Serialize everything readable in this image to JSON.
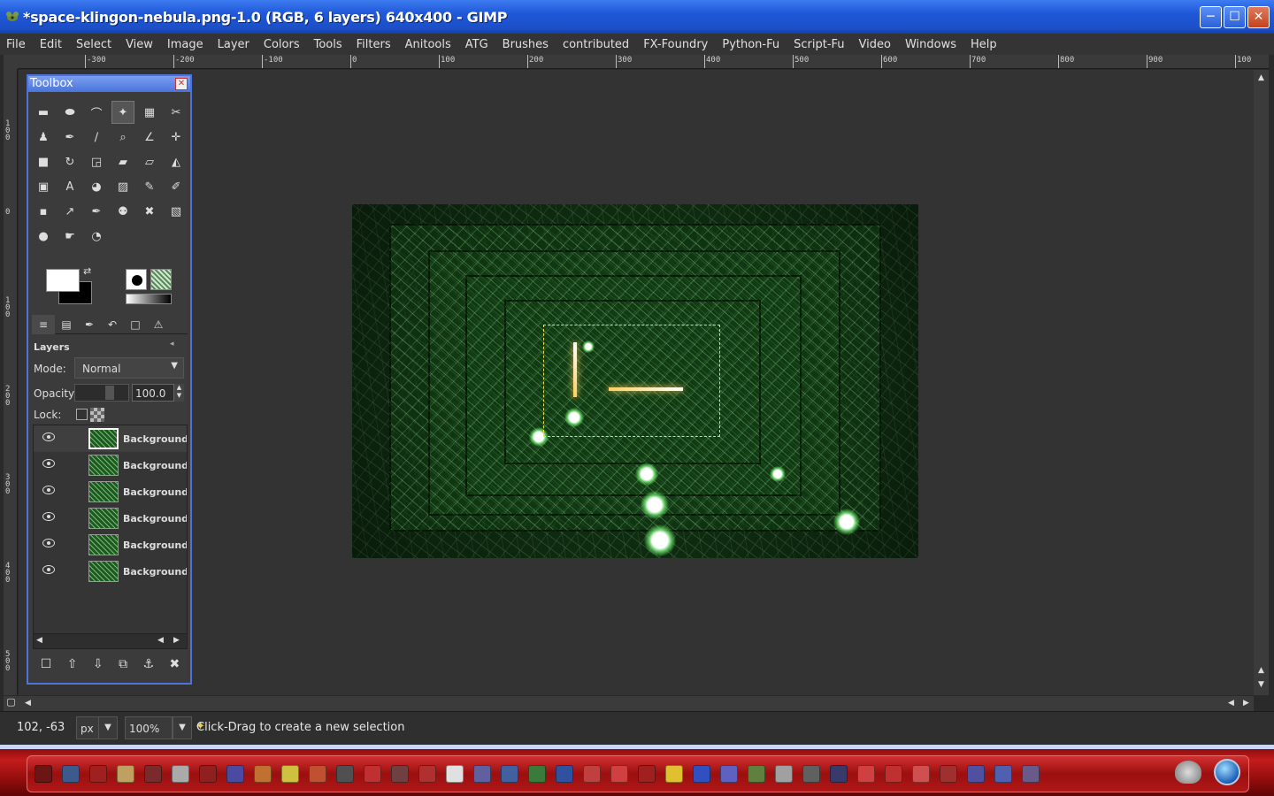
{
  "window": {
    "title": "*space-klingon-nebula.png-1.0 (RGB, 6 layers) 640x400 - GIMP",
    "minimize": "─",
    "maximize": "☐",
    "close": "✕"
  },
  "menubar": [
    "File",
    "Edit",
    "Select",
    "View",
    "Image",
    "Layer",
    "Colors",
    "Tools",
    "Filters",
    "Anitools",
    "ATG",
    "Brushes",
    "contributed",
    "FX-Foundry",
    "Python-Fu",
    "Script-Fu",
    "Video",
    "Windows",
    "Help"
  ],
  "ruler_top": [
    "-300",
    "-200",
    "-100",
    "0",
    "100",
    "200",
    "300",
    "400",
    "500",
    "600",
    "700",
    "800",
    "900",
    "100"
  ],
  "ruler_left": [
    "100",
    "0",
    "100",
    "200",
    "300",
    "400",
    "500"
  ],
  "toolbox": {
    "title": "Toolbox",
    "close": "✕",
    "tools": [
      {
        "icon": "rect-select-icon",
        "glyph": "▬"
      },
      {
        "icon": "ellipse-select-icon",
        "glyph": "⬬"
      },
      {
        "icon": "free-select-icon",
        "glyph": "⌒"
      },
      {
        "icon": "fuzzy-select-icon",
        "glyph": "✦"
      },
      {
        "icon": "select-by-color-icon",
        "glyph": "▦"
      },
      {
        "icon": "scissors-select-icon",
        "glyph": "✂"
      },
      {
        "icon": "foreground-select-icon",
        "glyph": "♟"
      },
      {
        "icon": "paths-icon",
        "glyph": "✒"
      },
      {
        "icon": "color-picker-icon",
        "glyph": "∕"
      },
      {
        "icon": "zoom-icon",
        "glyph": "⌕"
      },
      {
        "icon": "measure-icon",
        "glyph": "∠"
      },
      {
        "icon": "move-icon",
        "glyph": "✛"
      },
      {
        "icon": "crop-icon",
        "glyph": "■"
      },
      {
        "icon": "rotate-icon",
        "glyph": "↻"
      },
      {
        "icon": "scale-icon",
        "glyph": "◲"
      },
      {
        "icon": "shear-icon",
        "glyph": "▰"
      },
      {
        "icon": "perspective-icon",
        "glyph": "▱"
      },
      {
        "icon": "flip-icon",
        "glyph": "◭"
      },
      {
        "icon": "cage-icon",
        "glyph": "▣"
      },
      {
        "icon": "text-icon",
        "glyph": "A"
      },
      {
        "icon": "bucket-fill-icon",
        "glyph": "◕"
      },
      {
        "icon": "blend-icon",
        "glyph": "▨"
      },
      {
        "icon": "pencil-icon",
        "glyph": "✎"
      },
      {
        "icon": "paintbrush-icon",
        "glyph": "✐"
      },
      {
        "icon": "eraser-icon",
        "glyph": "▪"
      },
      {
        "icon": "airbrush-icon",
        "glyph": "↗"
      },
      {
        "icon": "ink-icon",
        "glyph": "✒"
      },
      {
        "icon": "clone-icon",
        "glyph": "⚉"
      },
      {
        "icon": "heal-icon",
        "glyph": "✖"
      },
      {
        "icon": "perspective-clone-icon",
        "glyph": "▧"
      },
      {
        "icon": "blur-icon",
        "glyph": "●"
      },
      {
        "icon": "smudge-icon",
        "glyph": "☛"
      },
      {
        "icon": "dodge-burn-icon",
        "glyph": "◔"
      }
    ]
  },
  "dock_tabs": [
    {
      "icon": "layers-tab-icon",
      "glyph": "≡"
    },
    {
      "icon": "channels-tab-icon",
      "glyph": "▤"
    },
    {
      "icon": "paths-tab-icon",
      "glyph": "✒"
    },
    {
      "icon": "undo-tab-icon",
      "glyph": "↶"
    },
    {
      "icon": "pointer-info-tab-icon",
      "glyph": "□"
    },
    {
      "icon": "error-console-tab-icon",
      "glyph": "⚠"
    }
  ],
  "layers": {
    "title": "Layers",
    "menu_button": "◂",
    "mode_label": "Mode:",
    "mode_value": "Normal",
    "opacity_label": "Opacity:",
    "opacity_value": "100.0",
    "lock_label": "Lock:",
    "items": [
      {
        "name": "Background c",
        "visible": true,
        "selected": true
      },
      {
        "name": "Background c",
        "visible": true,
        "selected": false
      },
      {
        "name": "Background c",
        "visible": true,
        "selected": false
      },
      {
        "name": "Background c",
        "visible": true,
        "selected": false
      },
      {
        "name": "Background c",
        "visible": true,
        "selected": false
      },
      {
        "name": "Background",
        "visible": true,
        "selected": false
      }
    ],
    "buttons": [
      {
        "icon": "new-layer-icon",
        "glyph": "☐"
      },
      {
        "icon": "raise-layer-icon",
        "glyph": "⇧"
      },
      {
        "icon": "lower-layer-icon",
        "glyph": "⇩"
      },
      {
        "icon": "duplicate-layer-icon",
        "glyph": "⧉"
      },
      {
        "icon": "anchor-layer-icon",
        "glyph": "⚓"
      },
      {
        "icon": "delete-layer-icon",
        "glyph": "✖"
      }
    ]
  },
  "statusbar": {
    "coords": "102, -63",
    "unit": "px",
    "zoom": "100",
    "zoom_suffix": "%",
    "message": "Click-Drag to create a new selection"
  },
  "taskbar_icons": [
    "#6b1515",
    "#3d5a8c",
    "#a02020",
    "#c0a060",
    "#7a2a2a",
    "#aaaaaa",
    "#902020",
    "#4a4aa0",
    "#c07030",
    "#d0c040",
    "#c05030",
    "#505050",
    "#c03030",
    "#704040",
    "#b03030",
    "#e0e0e0",
    "#6060a0",
    "#4060a0",
    "#3a7a3a",
    "#3050a0",
    "#c04040",
    "#d04040",
    "#a02020",
    "#e0c030",
    "#3050c0",
    "#6060c0",
    "#608040",
    "#a0a0a0",
    "#606060",
    "#3a3a6a",
    "#d04040",
    "#c03030",
    "#d05050",
    "#a03030",
    "#5050a0",
    "#5060b0",
    "#6a5a8a"
  ],
  "colors": {
    "accent": "#4f73d8",
    "selection": "#e8e048"
  }
}
